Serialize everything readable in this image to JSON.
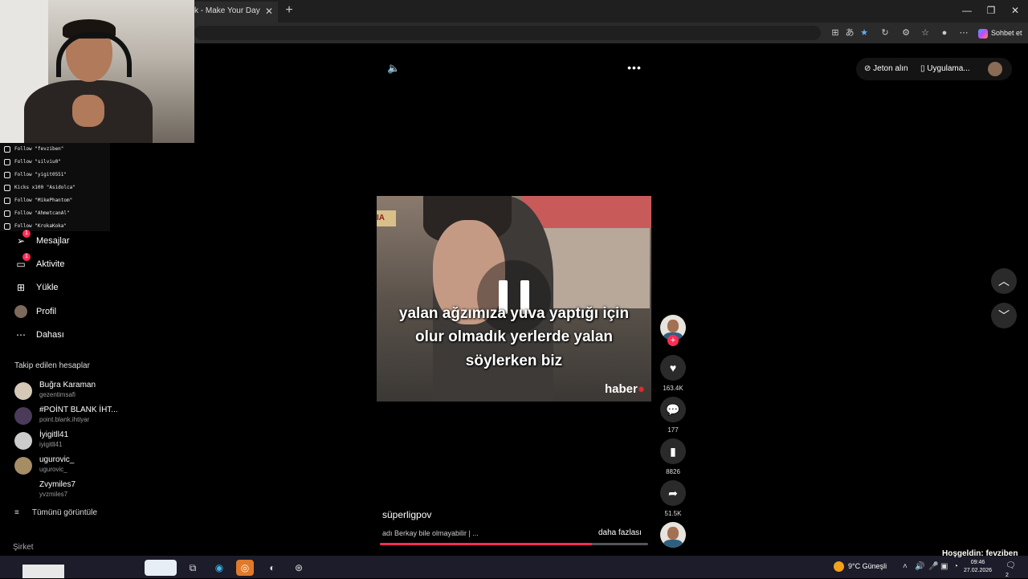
{
  "browser": {
    "tab_title": "k - Make Your Day",
    "tab_close": "✕",
    "new_tab": "+",
    "window": {
      "minimize": "—",
      "restore": "❐",
      "close": "✕"
    },
    "copilot_label": "Sohbet et"
  },
  "stream_overlay": {
    "follows": [
      "Follow \"fevziben\"",
      "Follow \"silviu0\"",
      "Follow \"yigit0551\"",
      "Kicks x100 \"Asidolca\"",
      "Follow \"MikePhantom\"",
      "Follow \"AhmetcanAl\"",
      "Follow \"KrokaKoka\""
    ]
  },
  "sidebar": {
    "nav": [
      {
        "label": "Mesajlar",
        "icon": "paper-plane-icon",
        "badge": "1"
      },
      {
        "label": "Aktivite",
        "icon": "activity-icon",
        "badge": "1"
      },
      {
        "label": "Yükle",
        "icon": "upload-icon"
      },
      {
        "label": "Profil",
        "icon": "profile-avatar-icon"
      },
      {
        "label": "Dahası",
        "icon": "more-dots-icon"
      }
    ],
    "followed_title": "Takip edilen hesaplar",
    "accounts": [
      {
        "name": "Buğra Karaman",
        "handle": "gezentimsafi"
      },
      {
        "name": "#POİNT BLANK İHT...",
        "handle": "point.blank.ihtiyar"
      },
      {
        "name": "İyigitll41",
        "handle": "iyigitll41"
      },
      {
        "name": "ugurovic_",
        "handle": "ugurovic_"
      },
      {
        "name": "Zvymiles7",
        "handle": "yvzmiles7"
      }
    ],
    "view_all": "Tümünü görüntüle",
    "company": "Şirket"
  },
  "player": {
    "top_right": {
      "coins": "Jeton alın",
      "app": "Uygulama..."
    },
    "subtitles": [
      "yalan ağzımıza yuva yaptığı için",
      "olur olmadık yerlerde yalan",
      "söylerken biz"
    ],
    "watermark": "haber",
    "actions": {
      "likes": "163.4K",
      "comments": "177",
      "saves": "8826",
      "shares": "51.5K"
    },
    "caption": {
      "username": "süperligpov",
      "description": "adı Berkay bile olmayabilir | ...",
      "more": "daha fazlası"
    },
    "progress": 0.79
  },
  "taskbar": {
    "welcome": "Hoşgeldin: fevziben",
    "weather": "9°C  Güneşli",
    "time": "09:46",
    "date": "27.02.2026",
    "notifications": "2"
  }
}
